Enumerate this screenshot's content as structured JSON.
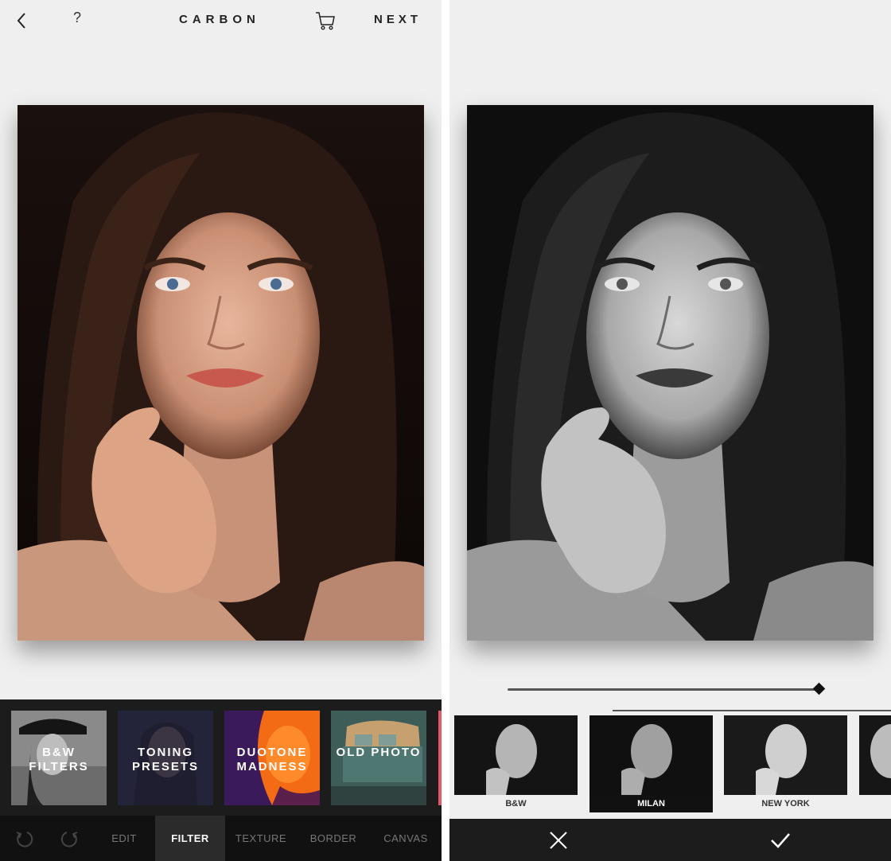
{
  "left": {
    "topbar": {
      "title": "CARBON",
      "help": "?",
      "next": "NEXT"
    },
    "categories": [
      {
        "label": "B&W FILTERS"
      },
      {
        "label": "TONING PRESETS"
      },
      {
        "label": "DUOTONE MADNESS"
      },
      {
        "label": "OLD PHOTO"
      }
    ],
    "tools": [
      "EDIT",
      "FILTER",
      "TEXTURE",
      "BORDER",
      "CANVAS"
    ],
    "active_tool": "FILTER"
  },
  "right": {
    "filters": [
      {
        "label": "B&W"
      },
      {
        "label": "MILAN"
      },
      {
        "label": "NEW YORK"
      }
    ],
    "selected_filter": "MILAN",
    "intensity": 1.0
  },
  "colors": {
    "accent": "#e4576a",
    "toolbar_bg": "#111111",
    "screen_bg": "#efefef"
  }
}
